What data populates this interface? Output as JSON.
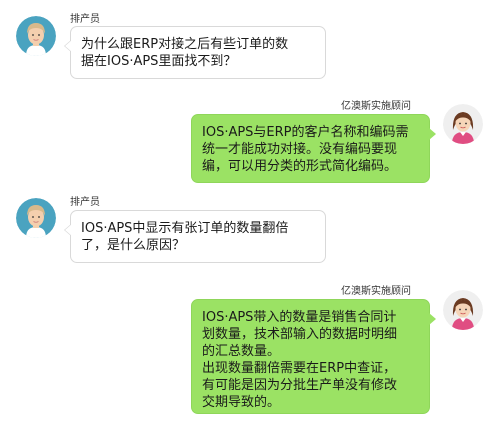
{
  "messages": [
    {
      "side": "left",
      "sender": "排产员",
      "lines": [
        "为什么跟ERP对接之后有些订单的数",
        "据在IOS·APS里面找不到？"
      ]
    },
    {
      "side": "right",
      "sender": "亿澳斯实施顾问",
      "lines": [
        "IOS·APS与ERP的客户名称和编码需",
        "统一才能成功对接。没有编码要现",
        "编，可以用分类的形式简化编码。"
      ]
    },
    {
      "side": "left",
      "sender": "排产员",
      "lines": [
        "IOS·APS中显示有张订单的数量翻倍",
        "了，是什么原因？"
      ]
    },
    {
      "side": "right",
      "sender": "亿澳斯实施顾问",
      "lines": [
        "IOS·APS带入的数量是销售合同计",
        "划数量，技术部输入的数据时明细",
        "的汇总数量。",
        "出现数量翻倍需要在ERP中查证，",
        "有可能是因为分批生产单没有修改",
        "交期导致的。"
      ]
    }
  ],
  "colors": {
    "left_bubble": "#ffffff",
    "right_bubble": "#9be264",
    "scheduler_avatar_bg": "#4aa3c0",
    "consultant_avatar_bg": "#efefef"
  },
  "icons": {
    "scheduler": "female-user-avatar-icon",
    "consultant": "female-consultant-avatar-icon"
  }
}
